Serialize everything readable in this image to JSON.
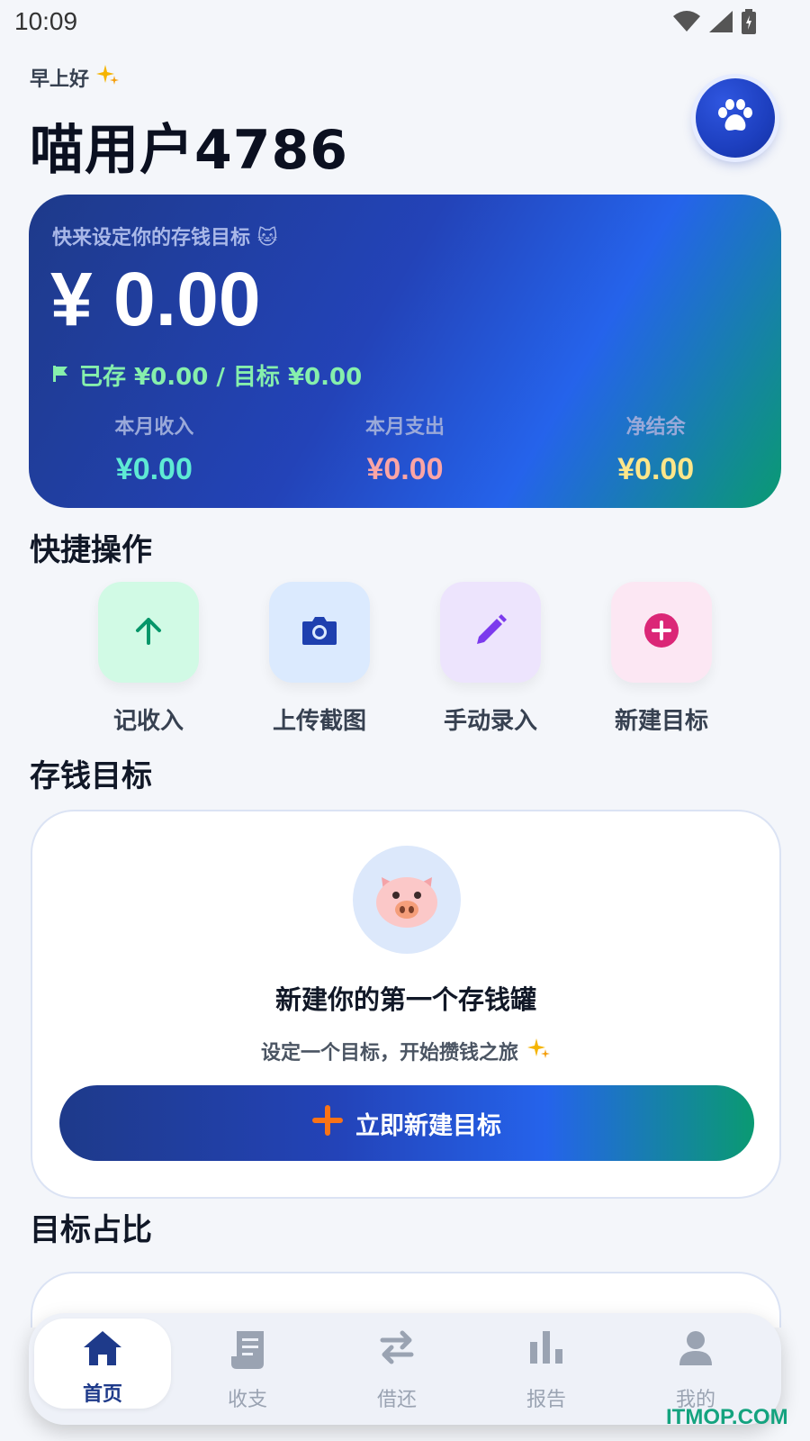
{
  "status_bar": {
    "time": "10:09",
    "icons": [
      "wifi-icon",
      "signal-icon",
      "battery-icon"
    ]
  },
  "header": {
    "greeting": "早上好",
    "username": "喵用户4786",
    "avatar_icon": "paw-icon"
  },
  "hero": {
    "prompt": "快来设定你的存钱目标 🐱",
    "amount": "¥ 0.00",
    "progress": "已存 ¥0.00 / 目标 ¥0.00",
    "stats": [
      {
        "label": "本月收入",
        "value": "¥0.00",
        "color": "#5eead4"
      },
      {
        "label": "本月支出",
        "value": "¥0.00",
        "color": "#fca5a5"
      },
      {
        "label": "净结余",
        "value": "¥0.00",
        "color": "#fde68a"
      }
    ]
  },
  "quick_actions": {
    "title": "快捷操作",
    "items": [
      {
        "label": "记收入",
        "icon": "arrow-up-icon",
        "bg": "#d1fae5",
        "color": "#059669"
      },
      {
        "label": "上传截图",
        "icon": "camera-icon",
        "bg": "#dbeafe",
        "color": "#1e40af"
      },
      {
        "label": "手动录入",
        "icon": "pencil-icon",
        "bg": "#ede4fd",
        "color": "#7c3aed"
      },
      {
        "label": "新建目标",
        "icon": "plus-circle-icon",
        "bg": "#fce7f3",
        "color": "#db2777"
      }
    ]
  },
  "savings_goals": {
    "title": "存钱目标",
    "empty_title": "新建你的第一个存钱罐",
    "empty_subtitle": "设定一个目标，开始攒钱之旅",
    "button_label": "立即新建目标"
  },
  "goal_ratio": {
    "title": "目标占比"
  },
  "bottom_nav": {
    "items": [
      {
        "label": "首页",
        "icon": "home-icon",
        "active": true
      },
      {
        "label": "收支",
        "icon": "receipt-icon",
        "active": false
      },
      {
        "label": "借还",
        "icon": "swap-icon",
        "active": false
      },
      {
        "label": "报告",
        "icon": "bar-chart-icon",
        "active": false
      },
      {
        "label": "我的",
        "icon": "person-icon",
        "active": false
      }
    ]
  },
  "watermark": "ITMOP.COM",
  "colors": {
    "primary": "#1e3a8a",
    "accent_green": "#0a9a72",
    "background": "#f4f6fa"
  }
}
